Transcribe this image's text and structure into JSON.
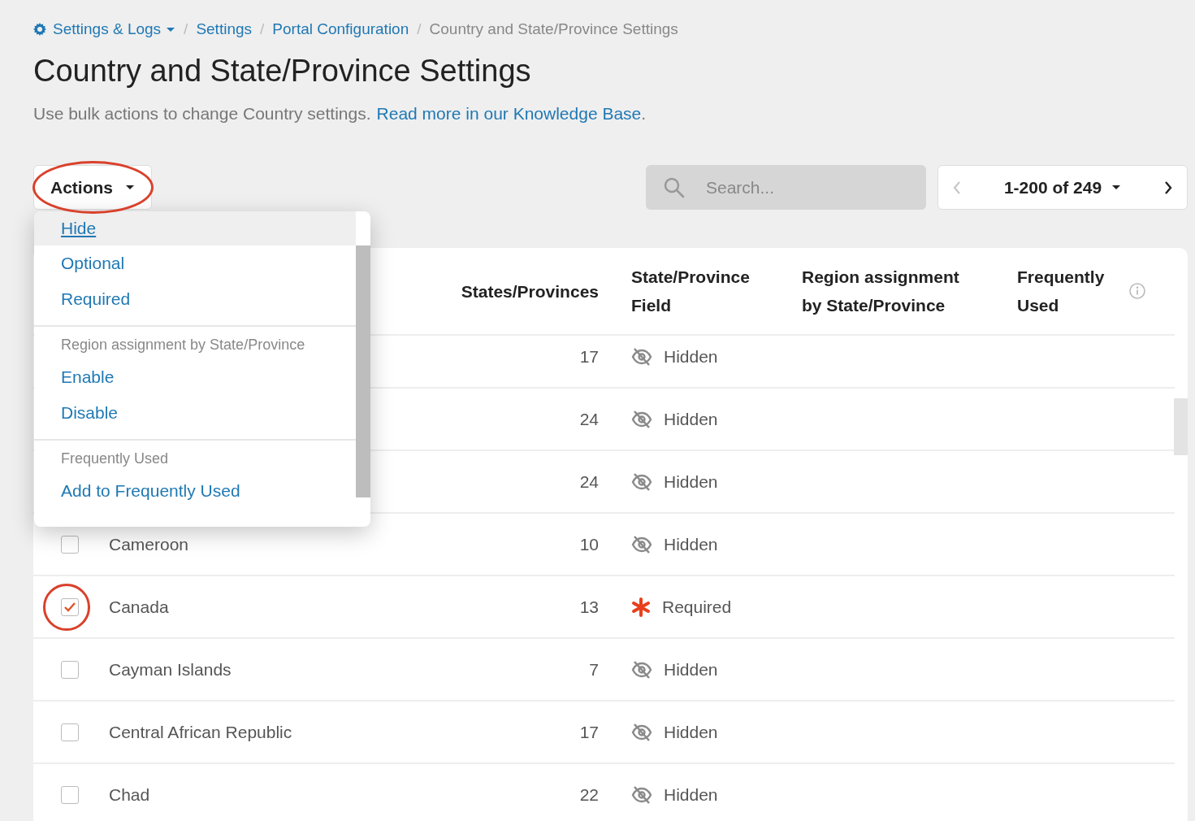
{
  "breadcrumb_separator": "/",
  "breadcrumb": [
    {
      "label": "Settings & Logs",
      "kind": "menu"
    },
    {
      "label": "Settings",
      "kind": "link"
    },
    {
      "label": "Portal Configuration",
      "kind": "link"
    },
    {
      "label": "Country and State/Province Settings",
      "kind": "current"
    }
  ],
  "title": "Country and State/Province Settings",
  "intro": {
    "text": "Use bulk actions to change Country settings.",
    "link": "Read more in our Knowledge Base",
    "end": "."
  },
  "actions_button": {
    "label": "Actions",
    "annotated": true
  },
  "actions_menu": {
    "groups": [
      {
        "items": [
          {
            "label": "Hide",
            "selected": true
          },
          {
            "label": "Optional",
            "selected": false
          },
          {
            "label": "Required",
            "selected": false
          }
        ]
      },
      {
        "heading": "Region assignment by State/Province",
        "items": [
          {
            "label": "Enable",
            "selected": false
          },
          {
            "label": "Disable",
            "selected": false
          }
        ]
      },
      {
        "heading": "Frequently Used",
        "items": [
          {
            "label": "Add to Frequently Used",
            "selected": false
          }
        ]
      }
    ]
  },
  "search": {
    "placeholder": "Search..."
  },
  "pager": {
    "range": "1-200 of 249",
    "previous_disabled": true
  },
  "table": {
    "columns": [
      "States/Provinces",
      "State/Province Field",
      "Region assignment by State/Province",
      "Frequently Used"
    ],
    "rows": [
      {
        "count": "17",
        "field": {
          "kind": "hidden",
          "label": "Hidden"
        }
      },
      {
        "count": "24",
        "field": {
          "kind": "hidden",
          "label": "Hidden"
        }
      },
      {
        "count": "24",
        "field": {
          "kind": "hidden",
          "label": "Hidden"
        }
      },
      {
        "country": "Cameroon",
        "checked": false,
        "count": "10",
        "field": {
          "kind": "hidden",
          "label": "Hidden"
        }
      },
      {
        "country": "Canada",
        "checked": true,
        "annotated": true,
        "count": "13",
        "field": {
          "kind": "required",
          "label": "Required"
        }
      },
      {
        "country": "Cayman Islands",
        "checked": false,
        "count": "7",
        "field": {
          "kind": "hidden",
          "label": "Hidden"
        }
      },
      {
        "country": "Central African Republic",
        "checked": false,
        "count": "17",
        "field": {
          "kind": "hidden",
          "label": "Hidden"
        }
      },
      {
        "country": "Chad",
        "checked": false,
        "count": "22",
        "field": {
          "kind": "hidden",
          "label": "Hidden"
        }
      }
    ]
  }
}
